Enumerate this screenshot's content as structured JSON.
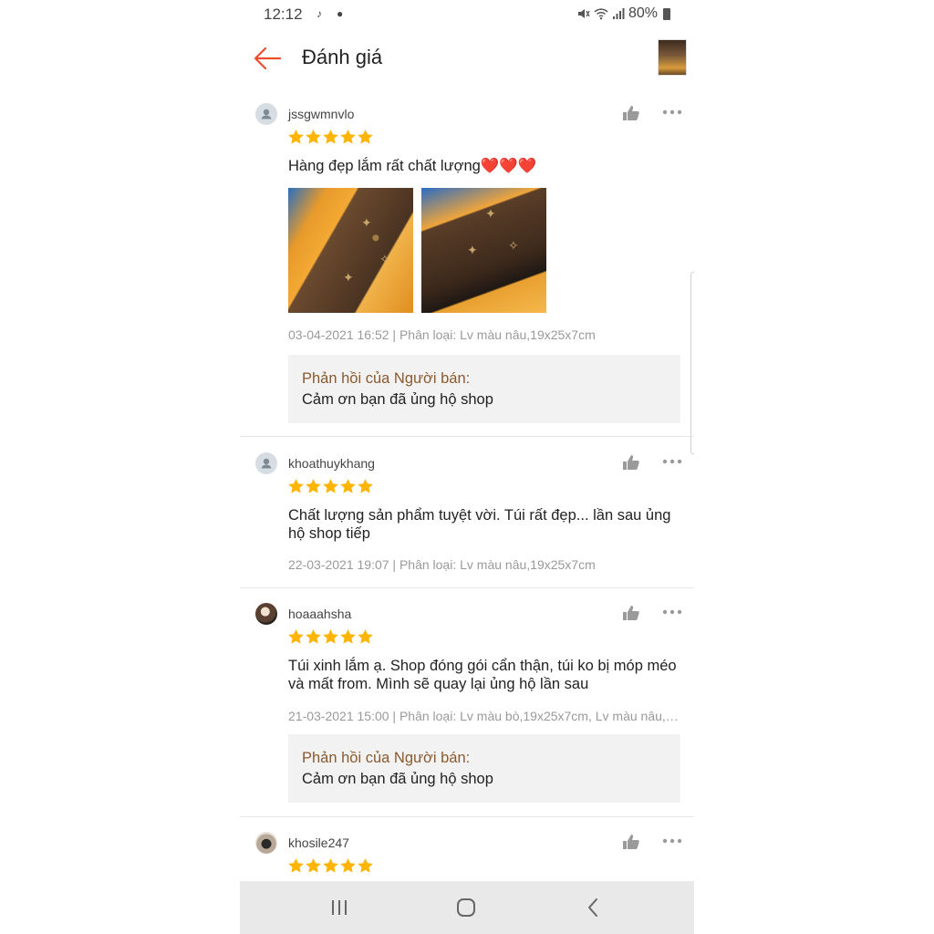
{
  "status_bar": {
    "time": "12:12",
    "battery": "80%"
  },
  "header": {
    "title": "Đánh giá"
  },
  "colors": {
    "accent": "#ee4d2d",
    "star": "#ffb400",
    "seller_reply_title": "#8a5a2e"
  },
  "reviews": [
    {
      "username": "jssgwmnvlo",
      "rating": 5,
      "comment": "Hàng đẹp lắm rất chất lượng❤️❤️❤️",
      "meta": "03-04-2021 16:52 | Phân loại: Lv màu nâu,19x25x7cm",
      "seller_reply": {
        "title": "Phản hồi của Người bán:",
        "text": "Cảm ơn bạn đã ủng hộ shop"
      }
    },
    {
      "username": "khoathuykhang",
      "rating": 5,
      "comment": "Chất lượng sản phẩm tuyệt vời. Túi rất đẹp... lần sau ủng hộ shop tiếp",
      "meta": "22-03-2021 19:07 | Phân loại: Lv màu nâu,19x25x7cm"
    },
    {
      "username": "hoaaahsha",
      "rating": 5,
      "comment": "Túi xinh lắm ạ. Shop đóng gói cẩn thận, túi ko bị móp méo và mất from. Mình sẽ quay lại ủng hộ lần sau",
      "meta": "21-03-2021 15:00 | Phân loại: Lv màu bò,19x25x7cm, Lv màu nâu,1...",
      "seller_reply": {
        "title": "Phản hồi của Người bán:",
        "text": "Cảm ơn bạn đã ủng hộ shop"
      }
    },
    {
      "username": "khosile247",
      "rating": 5
    }
  ]
}
